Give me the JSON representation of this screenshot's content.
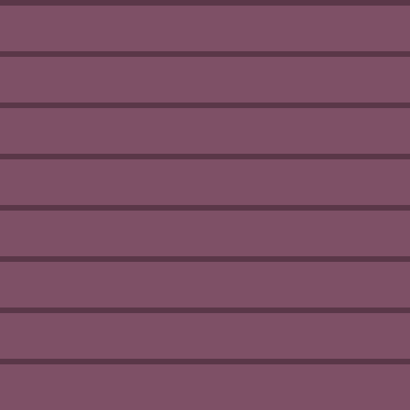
{
  "colors": {
    "background": "#7e5066",
    "stripe": "#5a3748"
  }
}
